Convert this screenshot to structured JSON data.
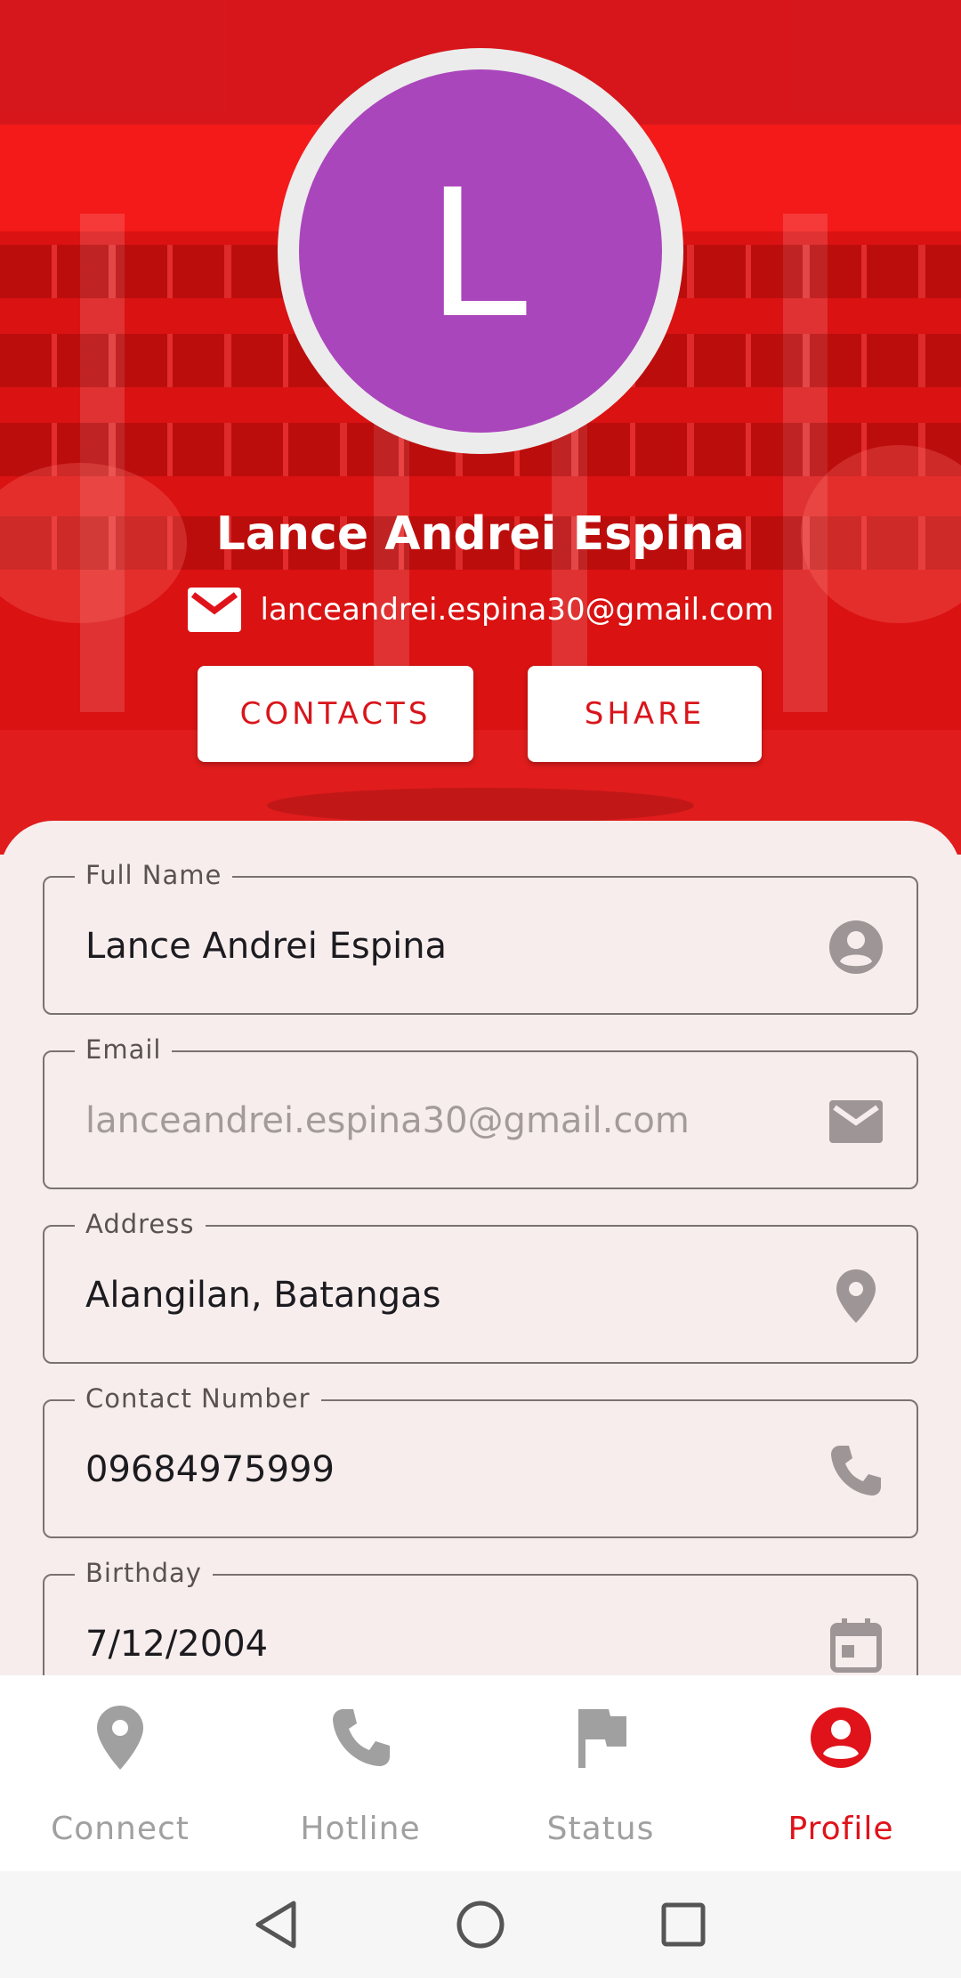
{
  "profile": {
    "avatar_initial": "L",
    "name": "Lance Andrei Espina",
    "email": "lanceandrei.espina30@gmail.com"
  },
  "actions": {
    "contacts_label": "CONTACTS",
    "share_label": "SHARE"
  },
  "form": {
    "full_name": {
      "label": "Full Name",
      "value": "Lance Andrei Espina",
      "icon": "account-circle-icon"
    },
    "email": {
      "label": "Email",
      "value": "lanceandrei.espina30@gmail.com",
      "icon": "mail-icon"
    },
    "address": {
      "label": "Address",
      "value": "Alangilan, Batangas",
      "icon": "location-pin-icon"
    },
    "contact_number": {
      "label": "Contact Number",
      "value": "09684975999",
      "icon": "phone-icon"
    },
    "birthday": {
      "label": "Birthday",
      "value": "7/12/2004",
      "icon": "calendar-icon"
    }
  },
  "nav": {
    "items": [
      {
        "label": "Connect",
        "icon": "location-pin-icon",
        "active": false
      },
      {
        "label": "Hotline",
        "icon": "phone-icon",
        "active": false
      },
      {
        "label": "Status",
        "icon": "flag-icon",
        "active": false
      },
      {
        "label": "Profile",
        "icon": "account-circle-icon",
        "active": true
      }
    ]
  },
  "colors": {
    "accent": "#e0131a",
    "header_tint": "#f41a1a",
    "avatar_bg": "#aa46bb",
    "inactive": "#a0a0a0"
  }
}
